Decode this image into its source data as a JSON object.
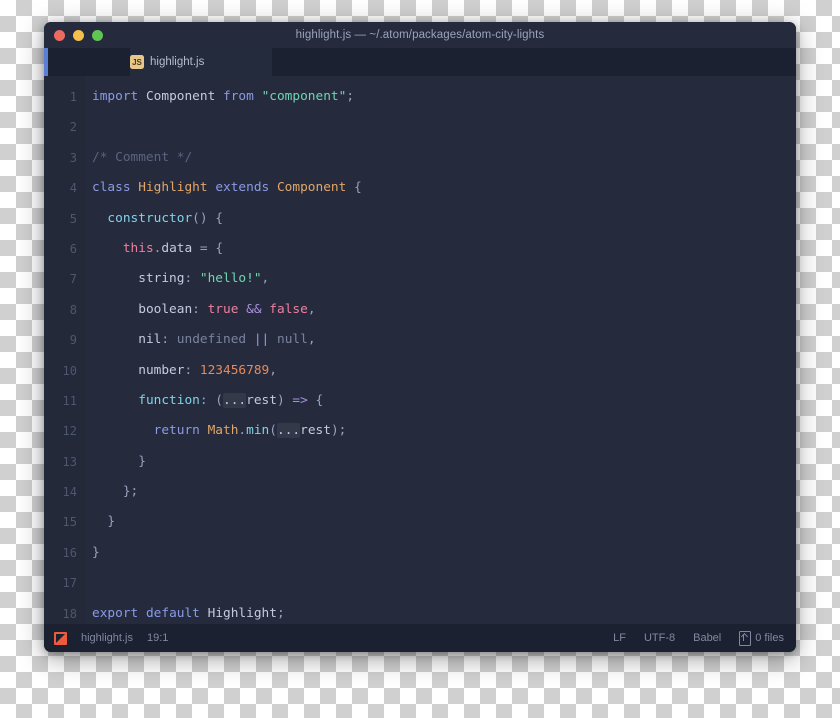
{
  "window": {
    "title": "highlight.js — ~/.atom/packages/atom-city-lights",
    "traffic_lights": [
      "close-red",
      "minimize-yellow",
      "maximize-green"
    ]
  },
  "tab": {
    "icon": "js-file-icon",
    "icon_label": "JS",
    "label": "highlight.js"
  },
  "editor": {
    "line_numbers": [
      "1",
      "2",
      "3",
      "4",
      "5",
      "6",
      "7",
      "8",
      "9",
      "10",
      "11",
      "12",
      "13",
      "14",
      "15",
      "16",
      "17",
      "18"
    ],
    "lines": [
      {
        "n": "1",
        "tokens": [
          {
            "t": "import",
            "c": "t-kw"
          },
          {
            "t": " ",
            "c": "t-punc"
          },
          {
            "t": "Component",
            "c": "t-ident"
          },
          {
            "t": " ",
            "c": "t-punc"
          },
          {
            "t": "from",
            "c": "t-kw"
          },
          {
            "t": " ",
            "c": "t-punc"
          },
          {
            "t": "\"component\"",
            "c": "t-str"
          },
          {
            "t": ";",
            "c": "t-punc"
          }
        ]
      },
      {
        "n": "2",
        "tokens": []
      },
      {
        "n": "3",
        "tokens": [
          {
            "t": "/* Comment */",
            "c": "t-com"
          }
        ]
      },
      {
        "n": "4",
        "tokens": [
          {
            "t": "class",
            "c": "t-kw"
          },
          {
            "t": " ",
            "c": "t-punc"
          },
          {
            "t": "Highlight",
            "c": "t-cls"
          },
          {
            "t": " ",
            "c": "t-punc"
          },
          {
            "t": "extends",
            "c": "t-kw"
          },
          {
            "t": " ",
            "c": "t-punc"
          },
          {
            "t": "Component",
            "c": "t-cls"
          },
          {
            "t": " ",
            "c": "t-punc"
          },
          {
            "t": "{",
            "c": "t-punc"
          }
        ]
      },
      {
        "n": "5",
        "tokens": [
          {
            "t": "  ",
            "c": "t-punc"
          },
          {
            "t": "constructor",
            "c": "t-fn"
          },
          {
            "t": "() {",
            "c": "t-punc"
          }
        ]
      },
      {
        "n": "6",
        "tokens": [
          {
            "t": "    ",
            "c": "t-punc"
          },
          {
            "t": "this",
            "c": "t-this"
          },
          {
            "t": ".",
            "c": "t-punc"
          },
          {
            "t": "data",
            "c": "t-prop"
          },
          {
            "t": " = {",
            "c": "t-punc"
          }
        ]
      },
      {
        "n": "7",
        "tokens": [
          {
            "t": "      ",
            "c": "t-punc"
          },
          {
            "t": "string",
            "c": "t-prop"
          },
          {
            "t": ": ",
            "c": "t-punc"
          },
          {
            "t": "\"hello!\"",
            "c": "t-str"
          },
          {
            "t": ",",
            "c": "t-punc"
          }
        ]
      },
      {
        "n": "8",
        "tokens": [
          {
            "t": "      ",
            "c": "t-punc"
          },
          {
            "t": "boolean",
            "c": "t-prop"
          },
          {
            "t": ": ",
            "c": "t-punc"
          },
          {
            "t": "true",
            "c": "t-bool"
          },
          {
            "t": " ",
            "c": "t-punc"
          },
          {
            "t": "&&",
            "c": "t-op"
          },
          {
            "t": " ",
            "c": "t-punc"
          },
          {
            "t": "false",
            "c": "t-bool"
          },
          {
            "t": ",",
            "c": "t-punc"
          }
        ]
      },
      {
        "n": "9",
        "tokens": [
          {
            "t": "      ",
            "c": "t-punc"
          },
          {
            "t": "nil",
            "c": "t-prop"
          },
          {
            "t": ": ",
            "c": "t-punc"
          },
          {
            "t": "undefined",
            "c": "t-null"
          },
          {
            "t": " ",
            "c": "t-punc"
          },
          {
            "t": "||",
            "c": "t-op"
          },
          {
            "t": " ",
            "c": "t-punc"
          },
          {
            "t": "null",
            "c": "t-null"
          },
          {
            "t": ",",
            "c": "t-punc"
          }
        ]
      },
      {
        "n": "10",
        "tokens": [
          {
            "t": "      ",
            "c": "t-punc"
          },
          {
            "t": "number",
            "c": "t-prop"
          },
          {
            "t": ": ",
            "c": "t-punc"
          },
          {
            "t": "123456789",
            "c": "t-num"
          },
          {
            "t": ",",
            "c": "t-punc"
          }
        ]
      },
      {
        "n": "11",
        "tokens": [
          {
            "t": "      ",
            "c": "t-punc"
          },
          {
            "t": "function",
            "c": "t-fn"
          },
          {
            "t": ": (",
            "c": "t-punc"
          },
          {
            "t": "...",
            "c": "t-spread"
          },
          {
            "t": "rest",
            "c": "t-ident"
          },
          {
            "t": ") ",
            "c": "t-punc"
          },
          {
            "t": "=>",
            "c": "t-op"
          },
          {
            "t": " {",
            "c": "t-punc"
          }
        ]
      },
      {
        "n": "12",
        "tokens": [
          {
            "t": "        ",
            "c": "t-punc"
          },
          {
            "t": "return",
            "c": "t-kw"
          },
          {
            "t": " ",
            "c": "t-punc"
          },
          {
            "t": "Math",
            "c": "t-cls"
          },
          {
            "t": ".",
            "c": "t-punc"
          },
          {
            "t": "min",
            "c": "t-fn"
          },
          {
            "t": "(",
            "c": "t-punc"
          },
          {
            "t": "...",
            "c": "t-spread"
          },
          {
            "t": "rest",
            "c": "t-ident"
          },
          {
            "t": ");",
            "c": "t-punc"
          }
        ]
      },
      {
        "n": "13",
        "tokens": [
          {
            "t": "      }",
            "c": "t-punc"
          }
        ]
      },
      {
        "n": "14",
        "tokens": [
          {
            "t": "    };",
            "c": "t-punc"
          }
        ]
      },
      {
        "n": "15",
        "tokens": [
          {
            "t": "  }",
            "c": "t-punc"
          }
        ]
      },
      {
        "n": "16",
        "tokens": [
          {
            "t": "}",
            "c": "t-punc"
          }
        ]
      },
      {
        "n": "17",
        "tokens": []
      },
      {
        "n": "18",
        "tokens": [
          {
            "t": "export",
            "c": "t-kw"
          },
          {
            "t": " ",
            "c": "t-punc"
          },
          {
            "t": "default",
            "c": "t-kw"
          },
          {
            "t": " ",
            "c": "t-punc"
          },
          {
            "t": "Highlight",
            "c": "t-ident"
          },
          {
            "t": ";",
            "c": "t-punc"
          }
        ]
      }
    ]
  },
  "statusbar": {
    "diff_icon": "git-diff-icon",
    "file_name": "highlight.js",
    "cursor_position": "19:1",
    "line_ending": "LF",
    "encoding": "UTF-8",
    "grammar": "Babel",
    "files_icon": "file-transfer-icon",
    "files_count": "0 files"
  },
  "colors": {
    "titlebar_bg": "#252b3d",
    "tabbar_bg": "#1b2130",
    "tab_active_bg": "#242b3d",
    "editor_bg": "#252b3d",
    "gutter_bg": "#232939",
    "statusbar_bg": "#1b2130",
    "accent_blue": "#5b7fd4",
    "diff_orange": "#f05a3c"
  }
}
